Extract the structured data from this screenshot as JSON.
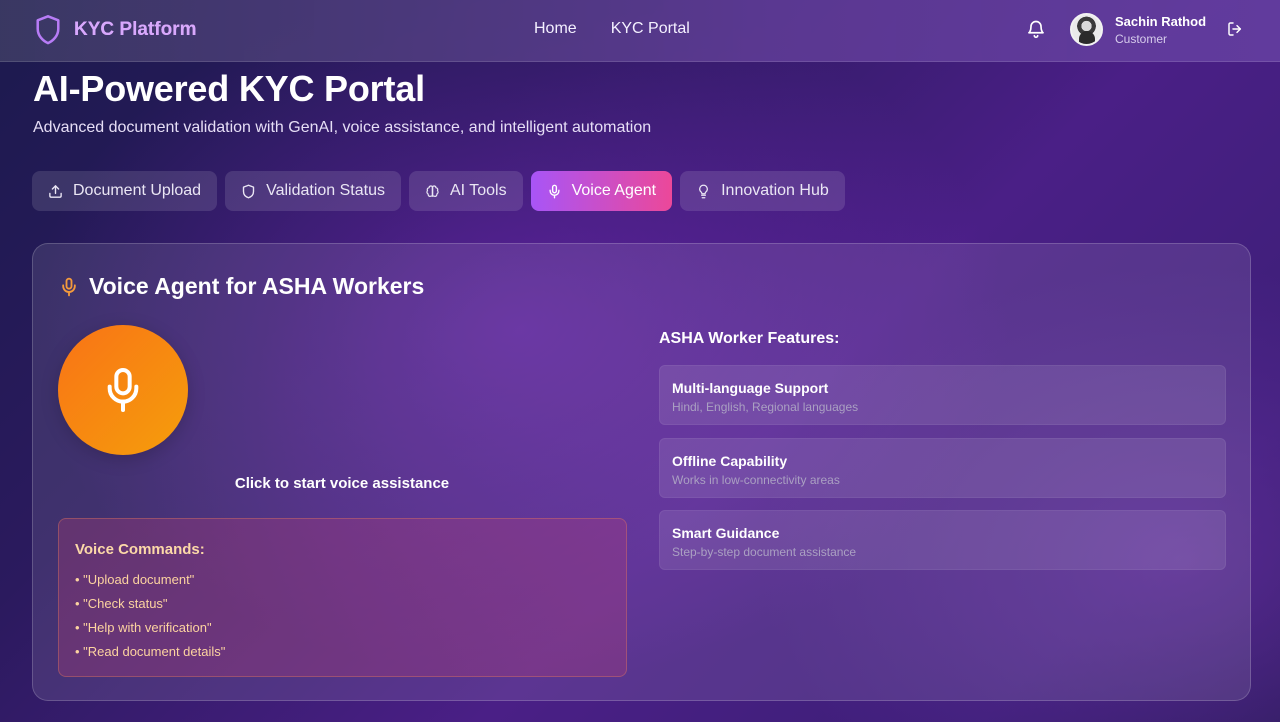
{
  "navbar": {
    "brand": "KYC Platform",
    "links": [
      "Home",
      "KYC Portal"
    ],
    "user": {
      "name": "Sachin Rathod",
      "role": "Customer"
    },
    "icons": [
      "shield-icon",
      "bell-icon",
      "avatar",
      "logout-icon"
    ]
  },
  "header": {
    "title": "AI-Powered KYC Portal",
    "subtitle": "Advanced document validation with GenAI, voice assistance, and intelligent automation"
  },
  "tabs": [
    {
      "label": "Document Upload",
      "icon": "upload-icon",
      "active": false
    },
    {
      "label": "Validation Status",
      "icon": "shield-icon",
      "active": false
    },
    {
      "label": "AI Tools",
      "icon": "brain-icon",
      "active": false
    },
    {
      "label": "Voice Agent",
      "icon": "mic-icon",
      "active": true
    },
    {
      "label": "Innovation Hub",
      "icon": "lightbulb-icon",
      "active": false
    }
  ],
  "voice_agent": {
    "title": "Voice Agent for ASHA Workers",
    "mic_caption": "Click to start voice assistance",
    "commands": {
      "title": "Voice Commands:",
      "items": [
        "• \"Upload document\"",
        "• \"Check status\"",
        "• \"Help with verification\"",
        "• \"Read document details\""
      ]
    },
    "features": {
      "title": "ASHA Worker Features:",
      "items": [
        {
          "title": "Multi-language Support",
          "desc": "Hindi, English, Regional languages"
        },
        {
          "title": "Offline Capability",
          "desc": "Works in low-connectivity areas"
        },
        {
          "title": "Smart Guidance",
          "desc": "Step-by-step document assistance"
        }
      ]
    }
  },
  "colors": {
    "accent_gradient_start": "#a855f7",
    "accent_gradient_end": "#ec4899",
    "mic_orange": "#f97316",
    "mic_amber": "#f59e0b",
    "command_text": "#fcd3a0"
  }
}
